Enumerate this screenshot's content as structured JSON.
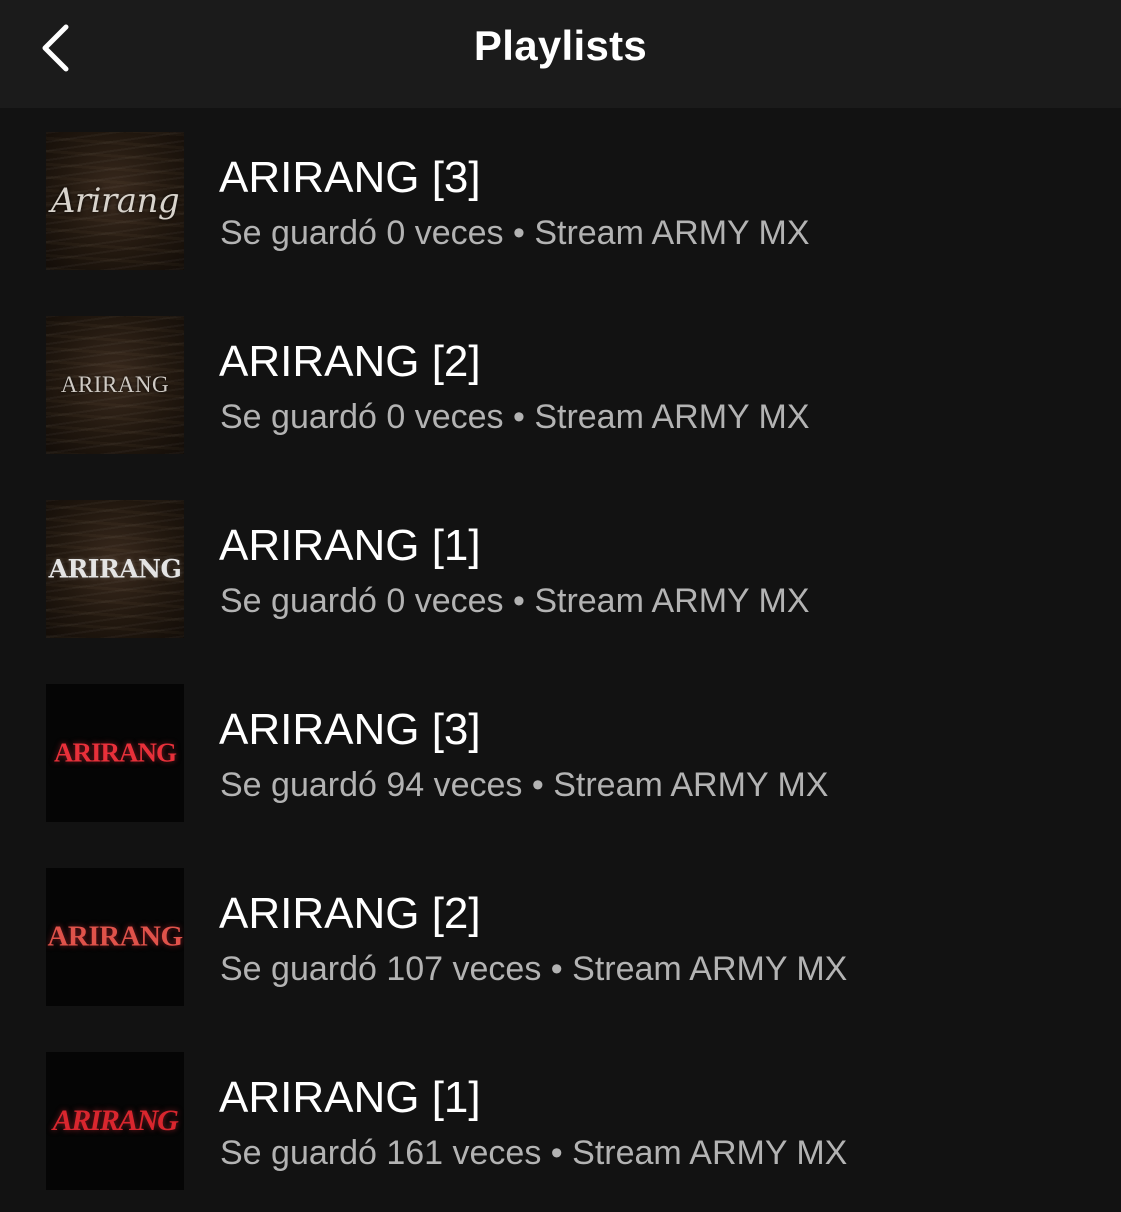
{
  "header": {
    "title": "Playlists",
    "back_icon": "chevron-left-icon"
  },
  "playlists": [
    {
      "cover_text": "Arirang",
      "cover_style": "dark-ocean-script",
      "title": "ARIRANG [3]",
      "subtitle": "Se guardó 0 veces • Stream ARMY MX"
    },
    {
      "cover_text": "ARIRANG",
      "cover_style": "dark-ocean-caps",
      "title": "ARIRANG [2]",
      "subtitle": "Se guardó 0 veces • Stream ARMY MX"
    },
    {
      "cover_text": "ARIRANG",
      "cover_style": "dark-ocean-silver",
      "title": "ARIRANG [1]",
      "subtitle": "Se guardó 0 veces • Stream ARMY MX"
    },
    {
      "cover_text": "ARIRANG",
      "cover_style": "black-red",
      "title": "ARIRANG [3]",
      "subtitle": "Se guardó 94 veces • Stream ARMY MX"
    },
    {
      "cover_text": "ARIRANG",
      "cover_style": "black-red",
      "title": "ARIRANG [2]",
      "subtitle": "Se guardó 107 veces • Stream ARMY MX"
    },
    {
      "cover_text": "ARIRANG",
      "cover_style": "black-red",
      "title": "ARIRANG [1]",
      "subtitle": "Se guardó 161 veces • Stream ARMY MX"
    }
  ],
  "colors": {
    "background": "#121212",
    "header_background": "#1b1b1b",
    "title_text": "#ffffff",
    "subtitle_text": "#b3b3b3",
    "red_accent": "#e8303a"
  }
}
